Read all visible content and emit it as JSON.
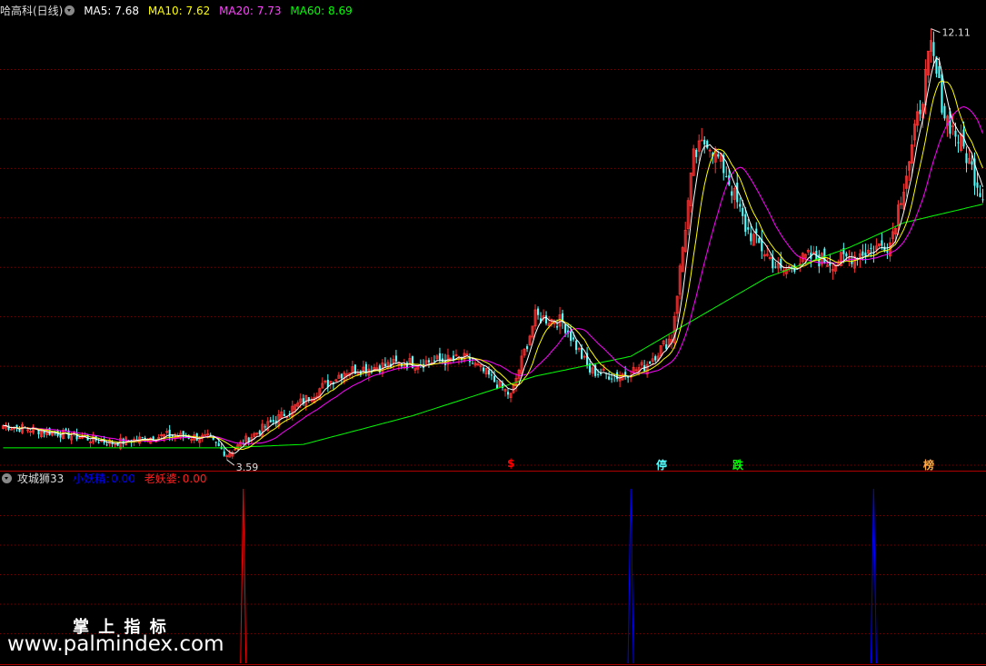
{
  "main_header": {
    "stock_name": "哈高科(日线)",
    "ma5": "MA5: 7.68",
    "ma10": "MA10: 7.62",
    "ma20": "MA20: 7.73",
    "ma60": "MA60: 8.69"
  },
  "sub_header": {
    "indicator_name": "攻城狮33",
    "xiaoyao_label": "小妖精:",
    "xiaoyao_value": "0.00",
    "laoyao_label": "老妖婆:",
    "laoyao_value": "0.00"
  },
  "colors": {
    "ma5": "#ffffff",
    "ma10": "#ffff00",
    "ma20": "#ff00ff",
    "ma60": "#00ff00",
    "up": "#ff3232",
    "down": "#54ffff",
    "xiaoyao": "#0000ff",
    "laoyao": "#ff0000"
  },
  "signals": [
    {
      "text": "$",
      "color": "#ff0000"
    },
    {
      "text": "停",
      "color": "#54ffff"
    },
    {
      "text": "跌",
      "color": "#00ff00"
    },
    {
      "text": "榜",
      "color": "#ffaa44"
    }
  ],
  "watermark": {
    "cn": "掌 上 指 标",
    "url": "www.palmindex.com"
  },
  "chart_data": {
    "type": "candlestick",
    "max_label": "12.11",
    "min_label": "3.59",
    "price_range": [
      3.4,
      12.4
    ],
    "n_bars": 360,
    "series": [
      {
        "name": "MA5",
        "legend_value": 7.68
      },
      {
        "name": "MA10",
        "legend_value": 7.62
      },
      {
        "name": "MA20",
        "legend_value": 7.73
      },
      {
        "name": "MA60",
        "legend_value": 8.69
      }
    ],
    "close_anchors": [
      [
        0,
        4.2
      ],
      [
        20,
        4.05
      ],
      [
        40,
        3.85
      ],
      [
        60,
        4.0
      ],
      [
        75,
        3.95
      ],
      [
        82,
        3.62
      ],
      [
        90,
        3.95
      ],
      [
        110,
        4.7
      ],
      [
        125,
        5.3
      ],
      [
        145,
        5.45
      ],
      [
        170,
        5.55
      ],
      [
        178,
        5.2
      ],
      [
        186,
        4.8
      ],
      [
        195,
        6.4
      ],
      [
        205,
        6.3
      ],
      [
        215,
        5.3
      ],
      [
        225,
        5.2
      ],
      [
        235,
        5.4
      ],
      [
        245,
        6.0
      ],
      [
        253,
        9.6
      ],
      [
        258,
        10.0
      ],
      [
        265,
        9.3
      ],
      [
        272,
        8.2
      ],
      [
        285,
        7.3
      ],
      [
        295,
        7.6
      ],
      [
        305,
        7.5
      ],
      [
        315,
        7.7
      ],
      [
        325,
        7.9
      ],
      [
        333,
        9.8
      ],
      [
        340,
        11.8
      ],
      [
        345,
        10.5
      ],
      [
        352,
        9.8
      ],
      [
        360,
        8.7
      ]
    ],
    "ma60_anchors": [
      [
        0,
        3.75
      ],
      [
        80,
        3.75
      ],
      [
        110,
        3.82
      ],
      [
        150,
        4.4
      ],
      [
        195,
        5.2
      ],
      [
        230,
        5.6
      ],
      [
        280,
        7.2
      ],
      [
        310,
        7.8
      ],
      [
        330,
        8.3
      ],
      [
        360,
        8.69
      ]
    ],
    "indicator": {
      "xiaoyao_values": [
        0.0
      ],
      "laoyao_values": [
        0.0
      ],
      "laoyao_spikes_at_bar": [
        88
      ],
      "xiaoyao_spikes_at_bar": [
        230,
        319
      ]
    }
  }
}
